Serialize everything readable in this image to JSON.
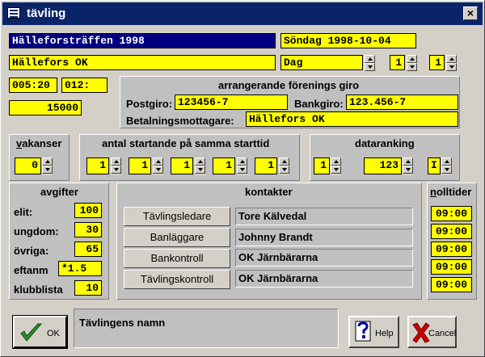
{
  "window": {
    "title": "tävling",
    "close_label": "×"
  },
  "event": {
    "name": "Hälleforsträffen 1998",
    "date": "Söndag 1998-10-04",
    "organizer": "Hällefors OK",
    "type": "Dag",
    "spin_a": "1",
    "spin_b": "1",
    "time": "005:20",
    "code": "012:",
    "amount": "15000"
  },
  "giro": {
    "title": "arrangerande förenings giro",
    "postgiro_label": "Postgiro:",
    "postgiro": "123456-7",
    "bankgiro_label": "Bankgiro:",
    "bankgiro": "123.456-7",
    "recipient_label": "Betalningsmottagare:",
    "recipient": "Hällefors OK"
  },
  "vakanser": {
    "title_underlined": "v",
    "title_rest": "akanser",
    "value": "0"
  },
  "starts": {
    "title": "antal startande på samma starttid",
    "values": [
      "1",
      "1",
      "1",
      "1",
      "1"
    ]
  },
  "dataranking": {
    "title": "dataranking",
    "a": "1",
    "b": "123",
    "c": "I"
  },
  "avgifter": {
    "title": "avgifter",
    "rows": [
      {
        "label": "elit:",
        "value": "100"
      },
      {
        "label": "ungdom:",
        "value": "30"
      },
      {
        "label": "övriga:",
        "value": "65"
      },
      {
        "label": "eftanm",
        "value": "*1.5"
      },
      {
        "label": "klubblista",
        "value": "10"
      }
    ]
  },
  "kontakter": {
    "title": "kontakter",
    "rows": [
      {
        "role": "Tävlingsledare",
        "name": "Tore Kälvedal"
      },
      {
        "role": "Banläggare",
        "name": "Johnny Brandt"
      },
      {
        "role": "Bankontroll",
        "name": "OK Järnbärarna"
      },
      {
        "role": "Tävlingskontroll",
        "name": "OK Järnbärarna"
      }
    ]
  },
  "nolltider": {
    "title_underlined": "n",
    "title_rest": "olltider",
    "values": [
      "09:00",
      "09:00",
      "09:00",
      "09:00",
      "09:00"
    ]
  },
  "footer": {
    "message": "Tävlingens namn",
    "ok": "OK",
    "help": "Help",
    "cancel": "Cancel"
  },
  "colors": {
    "field": "#ffff00",
    "selected": "#000080",
    "titlebar": "#0a246a",
    "ok_check": "#2e8b2e",
    "cancel_x": "#cc0000"
  }
}
